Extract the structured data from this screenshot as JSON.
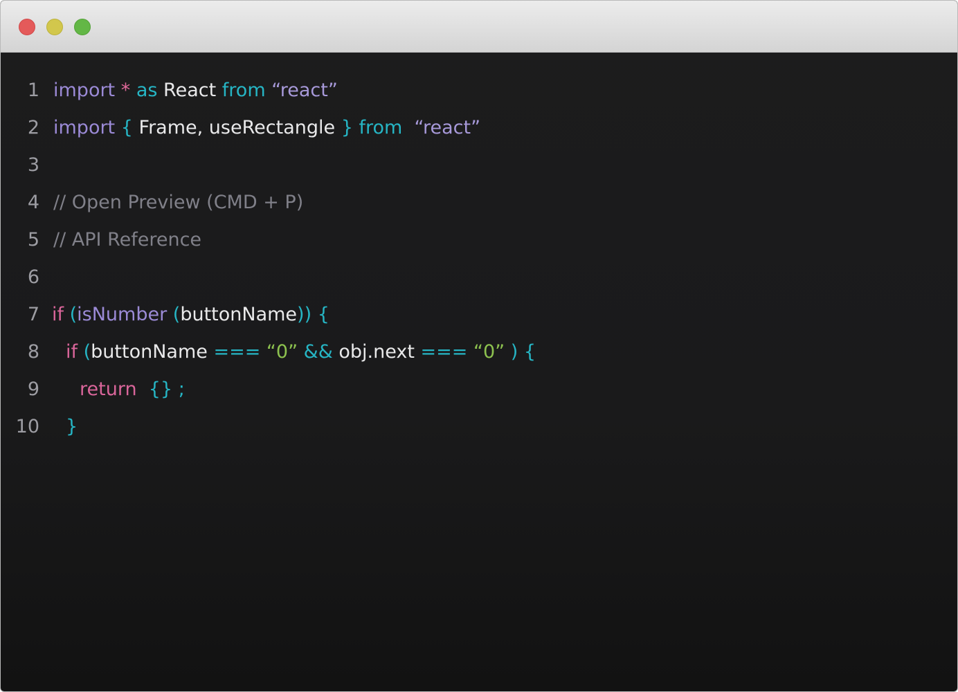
{
  "window": {
    "controls": {
      "close": "close",
      "minimize": "minimize",
      "maximize": "maximize"
    }
  },
  "editor": {
    "lines": [
      {
        "number": "1",
        "tokens": [
          {
            "text": "import",
            "kind": "purple"
          },
          {
            "text": " ",
            "kind": "white"
          },
          {
            "text": "*",
            "kind": "pink"
          },
          {
            "text": " ",
            "kind": "white"
          },
          {
            "text": "as",
            "kind": "teal"
          },
          {
            "text": " React ",
            "kind": "white"
          },
          {
            "text": "from",
            "kind": "teal"
          },
          {
            "text": " “react”",
            "kind": "string"
          }
        ]
      },
      {
        "number": "2",
        "tokens": [
          {
            "text": "import",
            "kind": "purple"
          },
          {
            "text": " ",
            "kind": "white"
          },
          {
            "text": "{",
            "kind": "teal"
          },
          {
            "text": " Frame, useRectangle ",
            "kind": "white"
          },
          {
            "text": "}",
            "kind": "teal"
          },
          {
            "text": " ",
            "kind": "white"
          },
          {
            "text": "from",
            "kind": "teal"
          },
          {
            "text": "  “react”",
            "kind": "string"
          }
        ]
      },
      {
        "number": "3",
        "tokens": []
      },
      {
        "number": "4",
        "tokens": [
          {
            "text": "// Open Preview (CMD + P)",
            "kind": "comment"
          }
        ]
      },
      {
        "number": "5",
        "tokens": [
          {
            "text": "// API Reference",
            "kind": "comment"
          }
        ]
      },
      {
        "number": "6",
        "tokens": []
      },
      {
        "number": "7",
        "indent": 0,
        "tokens": [
          {
            "text": "if",
            "kind": "keyword"
          },
          {
            "text": " ",
            "kind": "white"
          },
          {
            "text": "(",
            "kind": "teal"
          },
          {
            "text": "isNumber",
            "kind": "purple"
          },
          {
            "text": " ",
            "kind": "white"
          },
          {
            "text": "(",
            "kind": "teal"
          },
          {
            "text": "buttonName",
            "kind": "white"
          },
          {
            "text": "))",
            "kind": "teal"
          },
          {
            "text": " ",
            "kind": "white"
          },
          {
            "text": "{",
            "kind": "teal"
          }
        ]
      },
      {
        "number": "8",
        "indent": 1,
        "tokens": [
          {
            "text": "if",
            "kind": "keyword"
          },
          {
            "text": " ",
            "kind": "white"
          },
          {
            "text": "(",
            "kind": "teal"
          },
          {
            "text": "buttonName ",
            "kind": "white"
          },
          {
            "text": "===",
            "kind": "teal"
          },
          {
            "text": " ",
            "kind": "white"
          },
          {
            "text": "“0”",
            "kind": "green"
          },
          {
            "text": " ",
            "kind": "white"
          },
          {
            "text": "&&",
            "kind": "teal"
          },
          {
            "text": " obj.next ",
            "kind": "white"
          },
          {
            "text": "===",
            "kind": "teal"
          },
          {
            "text": " ",
            "kind": "white"
          },
          {
            "text": "“0”",
            "kind": "green"
          },
          {
            "text": " ",
            "kind": "white"
          },
          {
            "text": ")",
            "kind": "teal"
          },
          {
            "text": " ",
            "kind": "white"
          },
          {
            "text": "{",
            "kind": "teal"
          }
        ]
      },
      {
        "number": "9",
        "indent": 2,
        "tokens": [
          {
            "text": "return",
            "kind": "keyword"
          },
          {
            "text": "  ",
            "kind": "white"
          },
          {
            "text": "{}",
            "kind": "teal"
          },
          {
            "text": " ",
            "kind": "white"
          },
          {
            "text": ";",
            "kind": "teal"
          }
        ]
      },
      {
        "number": "10",
        "indent": 1,
        "tokens": [
          {
            "text": "}",
            "kind": "teal"
          }
        ]
      }
    ]
  },
  "colors": {
    "background": "#1a1a1b",
    "titlebar": "#e0e0e0",
    "close": "#e45a5a",
    "minimize": "#d2c74c",
    "maximize": "#63b746",
    "keyword_purple": "#9b8ad6",
    "keyword_pink": "#e0699a",
    "teal": "#26b5c4",
    "string": "#a799d9",
    "number_string": "#8dc24f",
    "comment": "#808089",
    "text": "#e9e9ea",
    "line_number": "#9d9da3"
  }
}
